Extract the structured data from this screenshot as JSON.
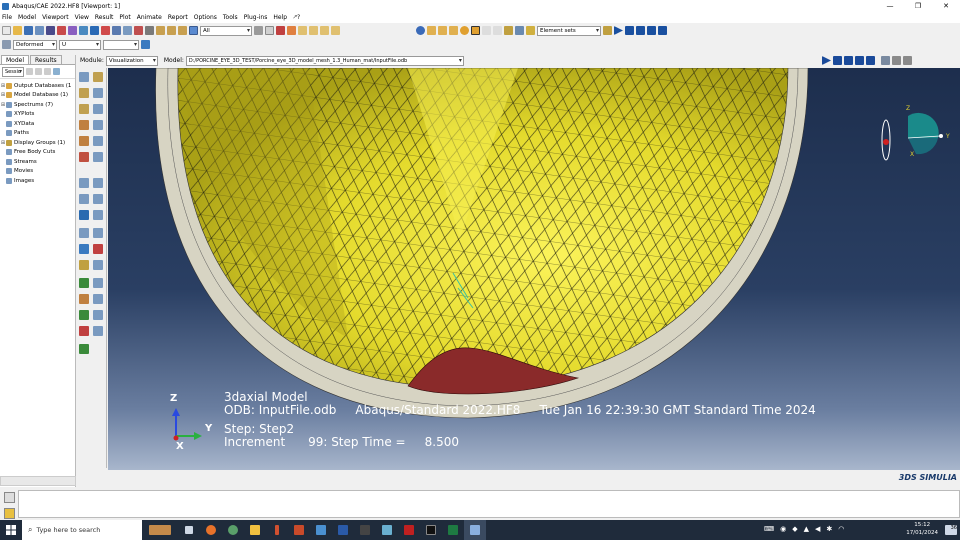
{
  "window": {
    "title": "Abaqus/CAE 2022.HF8 [Viewport: 1]",
    "controls": [
      "—",
      "❐",
      "✕"
    ]
  },
  "menubar": {
    "items": [
      "File",
      "Model",
      "Viewport",
      "View",
      "Result",
      "Plot",
      "Animate",
      "Report",
      "Options",
      "Tools",
      "Plug-ins",
      "Help",
      "🡕?"
    ]
  },
  "toolbar1": {
    "selection_filter": "All",
    "element_sets": "Element sets"
  },
  "toolbar2": {
    "deformed": "Deformed",
    "field": "U",
    "field_comp": ""
  },
  "context": {
    "module_label": "Module:",
    "module_value": "Visualization",
    "model_label": "Model:",
    "model_value": "D:/PORCINE_EYE_3D_TEST/Porcine_eye_3D_model_mesh_1.3_Human_mat/InputFile.odb"
  },
  "left_panel": {
    "tabs": [
      "Model",
      "Results"
    ],
    "session_combo": "Sessio",
    "tree": [
      {
        "label": "Output Databases (1",
        "expand": "⊞"
      },
      {
        "label": "Model Database (1)",
        "expand": "⊞"
      },
      {
        "label": "Spectrums (7)",
        "expand": "⊞"
      },
      {
        "label": "XYPlots",
        "expand": ""
      },
      {
        "label": "XYData",
        "expand": ""
      },
      {
        "label": "Paths",
        "expand": ""
      },
      {
        "label": "Display Groups (1)",
        "expand": "⊞"
      },
      {
        "label": "Free Body Cuts",
        "expand": ""
      },
      {
        "label": "Streams",
        "expand": ""
      },
      {
        "label": "Movies",
        "expand": ""
      },
      {
        "label": "Images",
        "expand": ""
      }
    ]
  },
  "viewport": {
    "model_title": "3daxial Model",
    "odb_line": "ODB: InputFile.odb     Abaqus/Standard 2022.HF8     Tue Jan 16 22:39:30 GMT Standard Time 2024",
    "step_line": "Step: Step2",
    "increment_line": "Increment      99: Step Time =     8.500",
    "triad": {
      "z": "Z",
      "y": "Y",
      "x": "X"
    },
    "colors": {
      "mesh_fill": "#e9e233",
      "mesh_dark": "#b3a91c",
      "rim": "#d4d2c4",
      "cavity": "#8a2a2a"
    }
  },
  "branding": {
    "simulia": "3DS SIMULIA"
  },
  "taskbar": {
    "search_placeholder": "Type here to search",
    "time": "15:12",
    "date": "17/01/2024",
    "badge": "36"
  }
}
